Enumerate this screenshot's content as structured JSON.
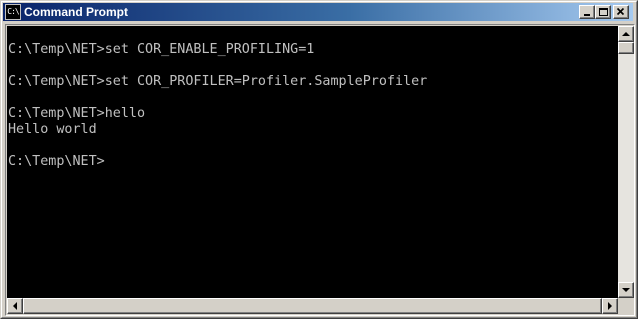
{
  "window": {
    "title": "Command Prompt",
    "icon_text": "C:\\"
  },
  "title_buttons": {
    "minimize": "minimize-icon",
    "maximize": "maximize-icon",
    "close": "close-icon"
  },
  "console": {
    "lines": [
      "C:\\Temp\\NET>set COR_ENABLE_PROFILING=1",
      "",
      "C:\\Temp\\NET>set COR_PROFILER=Profiler.SampleProfiler",
      "",
      "C:\\Temp\\NET>hello",
      "Hello world",
      "",
      "C:\\Temp\\NET>"
    ]
  },
  "scrollbars": {
    "vertical": {
      "up": "arrow-up-icon",
      "down": "arrow-down-icon"
    },
    "horizontal": {
      "left": "arrow-left-icon",
      "right": "arrow-right-icon"
    }
  },
  "colors": {
    "title_active_start": "#0a246a",
    "title_active_end": "#a6caf0",
    "console_bg": "#000000",
    "console_text": "#c0c0c0",
    "chrome": "#d4d0c8"
  }
}
